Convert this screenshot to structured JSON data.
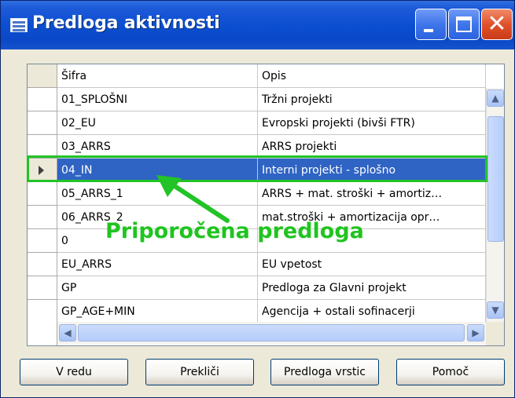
{
  "window": {
    "title": "Predloga aktivnosti"
  },
  "columns": {
    "code": "Šifra",
    "description": "Opis"
  },
  "rows": [
    {
      "code": "01_SPLOŠNI",
      "description": "Tržni projekti",
      "selected": false
    },
    {
      "code": "02_EU",
      "description": "Evropski projekti (bivši FTR)",
      "selected": false
    },
    {
      "code": "03_ARRS",
      "description": "ARRS projekti",
      "selected": false
    },
    {
      "code": "04_IN",
      "description": "Interni projekti - splošno",
      "selected": true
    },
    {
      "code": "05_ARRS_1",
      "description": "ARRS + mat. stroški + amortiz…",
      "selected": false
    },
    {
      "code": "06_ARRS_2",
      "description": "mat.stroški + amortizacija opr…",
      "selected": false
    },
    {
      "code": "0",
      "description": "",
      "selected": false
    },
    {
      "code": "EU_ARRS",
      "description": "EU vpetost",
      "selected": false
    },
    {
      "code": "GP",
      "description": "Predloga za Glavni projekt",
      "selected": false
    },
    {
      "code": "GP_AGE+MIN",
      "description": "Agencija + ostali sofinacerji",
      "selected": false
    }
  ],
  "annotation": {
    "text": "Priporočena predloga",
    "color": "#20c420"
  },
  "buttons": {
    "ok": "V redu",
    "cancel": "Prekliči",
    "line_template": "Predloga vrstic",
    "help": "Pomoč"
  },
  "colors": {
    "titlebar": "#0c4fd1",
    "selection": "#2f63c4",
    "highlight": "#22c327"
  }
}
